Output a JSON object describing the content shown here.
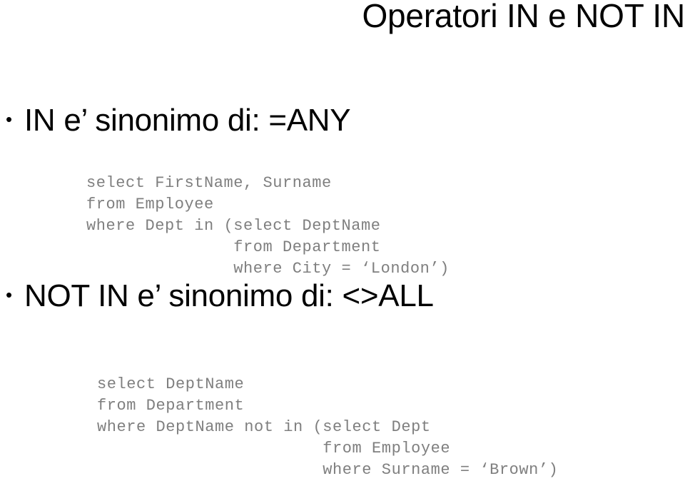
{
  "slide": {
    "title": "Operatori IN e NOT IN",
    "background_color": "#ffffff",
    "title_color": "#000000",
    "bullet_text_color": "#000000",
    "code_color": "#7f7f7f",
    "bullet_glyph": "•"
  },
  "bullets": [
    {
      "marker": "•",
      "text": "IN e’ sinonimo di: =ANY"
    },
    {
      "marker": "•",
      "text": "NOT IN e’ sinonimo di: <>ALL"
    }
  ],
  "code_blocks": [
    {
      "name": "in-example-query",
      "lines": [
        "select FirstName, Surname",
        "from Employee",
        "where Dept in (select DeptName",
        "               from Department",
        "               where City = ‘London’)"
      ]
    },
    {
      "name": "not-in-example-query",
      "lines": [
        "select DeptName",
        "from Department",
        "where DeptName not in (select Dept",
        "                       from Employee",
        "                       where Surname = ‘Brown’)"
      ]
    }
  ]
}
